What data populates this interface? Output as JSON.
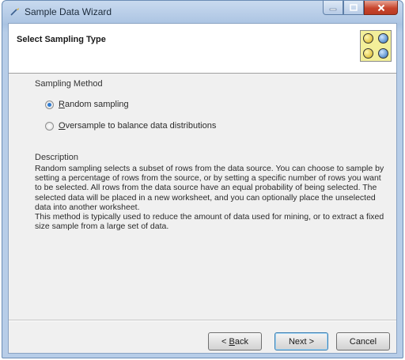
{
  "window": {
    "title": "Sample Data Wizard"
  },
  "header": {
    "page_title": "Select Sampling Type"
  },
  "sampling_method": {
    "label": "Sampling Method",
    "options": [
      {
        "accel": "R",
        "rest": "andom sampling",
        "selected": true
      },
      {
        "accel": "O",
        "rest": "versample to balance data distributions",
        "selected": false
      }
    ]
  },
  "description": {
    "label": "Description",
    "paragraph1": "Random sampling selects a subset of rows from the data source.  You can choose to sample by setting a percentage of rows from the source, or by setting a specific number of rows you want to be selected.  All rows from the data source have an equal probability of being selected.  The selected data will be placed in a new worksheet, and you can optionally place the unselected data into another worksheet.",
    "paragraph2": "This method is typically used to reduce the amount of data used for mining, or to extract a fixed size sample from a large set of data."
  },
  "buttons": {
    "back_prefix": "< ",
    "back_accel": "B",
    "back_rest": "ack",
    "next": "Next >",
    "cancel": "Cancel"
  },
  "colors": {
    "accent": "#2f7bd1",
    "logo_background": "#f3ef9a"
  }
}
